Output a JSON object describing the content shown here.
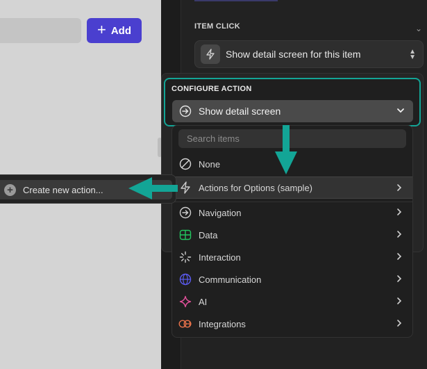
{
  "canvas": {
    "add_button_label": "Add"
  },
  "panel": {
    "item_click_label": "ITEM CLICK",
    "item_click_value": "Show detail screen for this item"
  },
  "configure_action": {
    "label": "CONFIGURE ACTION",
    "selected": "Show detail screen"
  },
  "menu": {
    "search_placeholder": "Search items",
    "items": [
      {
        "label": "None",
        "icon": "none-icon"
      },
      {
        "label": "Actions for Options (sample)",
        "icon": "bolt-icon",
        "highlighted": true
      },
      {
        "label": "Navigation",
        "icon": "navigation-icon"
      },
      {
        "label": "Data",
        "icon": "data-icon",
        "color": "#22c55e"
      },
      {
        "label": "Interaction",
        "icon": "interaction-icon"
      },
      {
        "label": "Communication",
        "icon": "globe-icon",
        "color": "#5b5bf0"
      },
      {
        "label": "AI",
        "icon": "sparkle-icon",
        "color": "#e0509a"
      },
      {
        "label": "Integrations",
        "icon": "integrations-icon",
        "color": "#e8724a"
      }
    ]
  },
  "submenu": {
    "create_label": "Create new action..."
  },
  "colors": {
    "accent": "#4a3fcf",
    "highlight_teal": "#13a596"
  }
}
